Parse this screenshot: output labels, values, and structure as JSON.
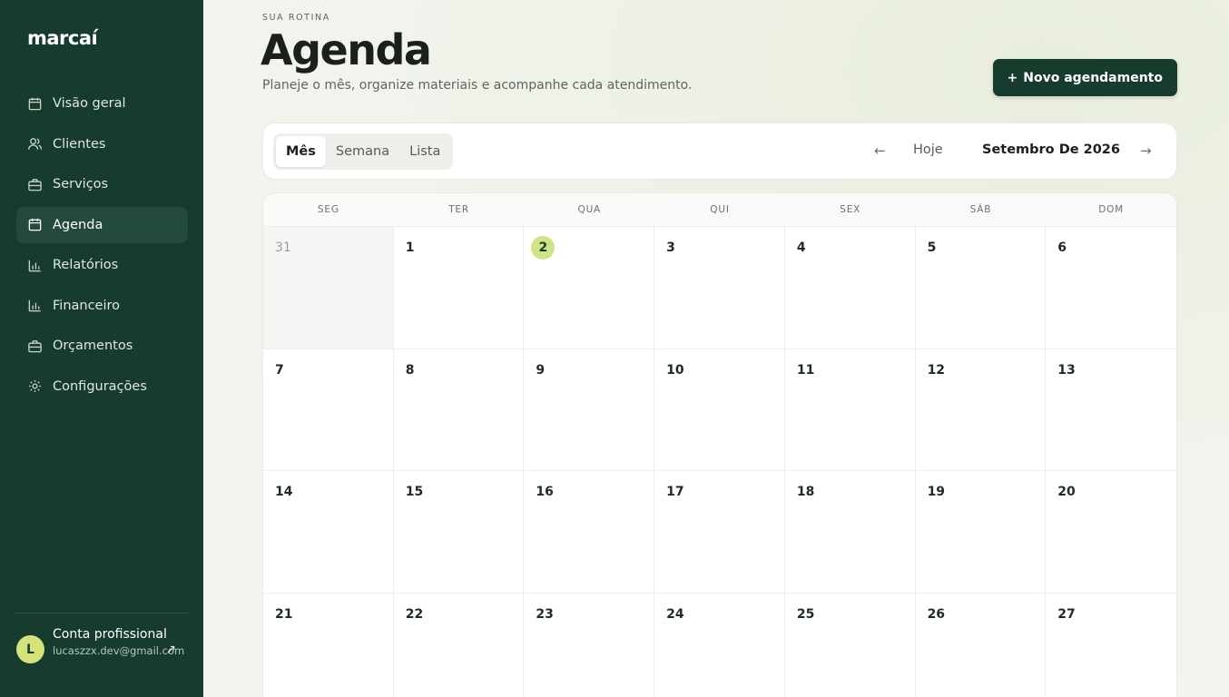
{
  "app": {
    "logo": "marcaí"
  },
  "sidebar": {
    "items": [
      {
        "label": "Visão geral",
        "icon": "calendar-icon",
        "active": false
      },
      {
        "label": "Clientes",
        "icon": "users-icon",
        "active": false
      },
      {
        "label": "Serviços",
        "icon": "briefcase-icon",
        "active": false
      },
      {
        "label": "Agenda",
        "icon": "calendar-icon",
        "active": true
      },
      {
        "label": "Relatórios",
        "icon": "bar-chart-icon",
        "active": false
      },
      {
        "label": "Financeiro",
        "icon": "bar-chart-icon",
        "active": false
      },
      {
        "label": "Orçamentos",
        "icon": "briefcase-icon",
        "active": false
      },
      {
        "label": "Configurações",
        "icon": "gear-icon",
        "active": false
      }
    ],
    "account": {
      "avatar_initial": "L",
      "name": "Conta profissional",
      "email": "lucaszzx.dev@gmail.com",
      "link_icon": "↗"
    }
  },
  "header": {
    "eyebrow": "SUA ROTINA",
    "title": "Agenda",
    "subtitle": "Planeje o mês, organize materiais e acompanhe cada atendimento.",
    "new_button": {
      "icon": "+",
      "label": "Novo agendamento"
    }
  },
  "toolbar": {
    "views": [
      {
        "label": "Mês",
        "active": true
      },
      {
        "label": "Semana",
        "active": false
      },
      {
        "label": "Lista",
        "active": false
      }
    ],
    "prev_icon": "←",
    "today_label": "Hoje",
    "month_label": "Setembro De 2026",
    "next_icon": "→"
  },
  "calendar": {
    "weekdays": [
      "SEG",
      "TER",
      "QUA",
      "QUI",
      "SEX",
      "SÁB",
      "DOM"
    ],
    "days": [
      {
        "n": "31",
        "outside": true
      },
      {
        "n": "1"
      },
      {
        "n": "2",
        "today": true
      },
      {
        "n": "3"
      },
      {
        "n": "4"
      },
      {
        "n": "5"
      },
      {
        "n": "6"
      },
      {
        "n": "7"
      },
      {
        "n": "8"
      },
      {
        "n": "9"
      },
      {
        "n": "10"
      },
      {
        "n": "11"
      },
      {
        "n": "12"
      },
      {
        "n": "13"
      },
      {
        "n": "14"
      },
      {
        "n": "15"
      },
      {
        "n": "16"
      },
      {
        "n": "17"
      },
      {
        "n": "18"
      },
      {
        "n": "19"
      },
      {
        "n": "20"
      },
      {
        "n": "21"
      },
      {
        "n": "22"
      },
      {
        "n": "23"
      },
      {
        "n": "24"
      },
      {
        "n": "25"
      },
      {
        "n": "26"
      },
      {
        "n": "27"
      }
    ]
  },
  "colors": {
    "sidebar": "#173b2d",
    "accent": "#cfe389",
    "primary_button": "#173b2d"
  }
}
